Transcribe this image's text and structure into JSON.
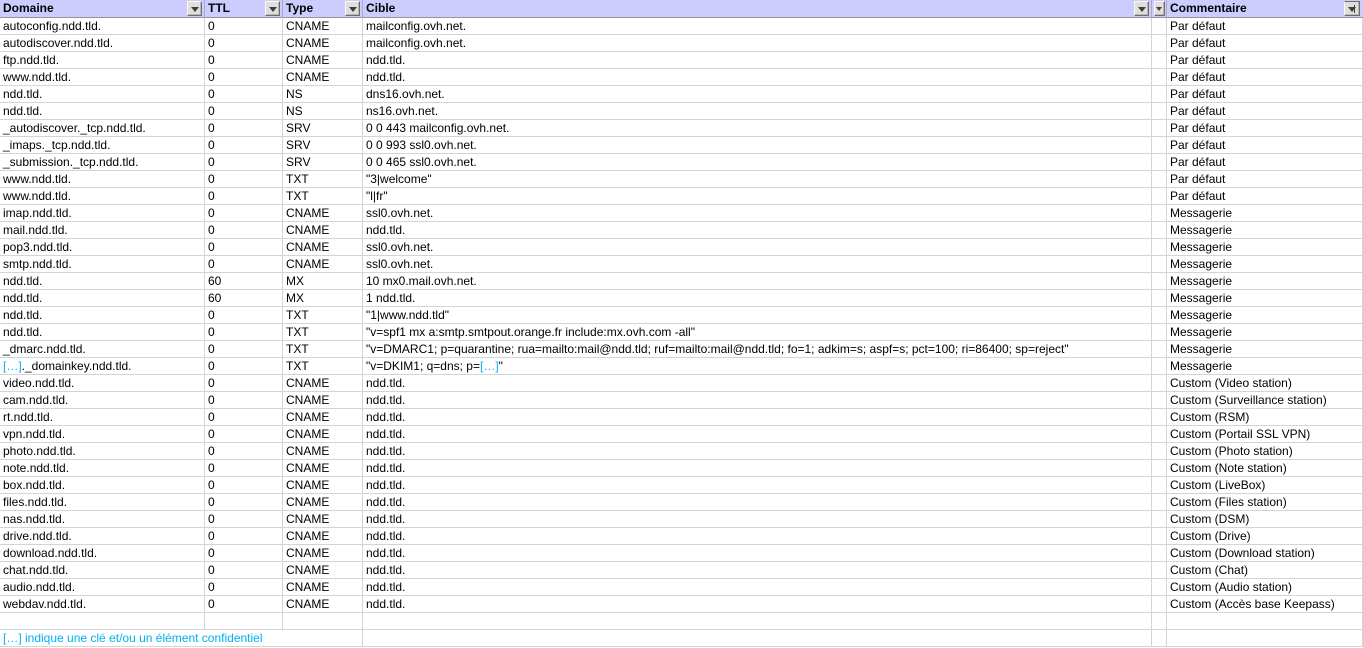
{
  "colors": {
    "header_bg": "#CCCCFF",
    "accent_cyan": "#00B0F0",
    "grid": "#D4D4D4"
  },
  "icons": {
    "filter_dropdown": "▼"
  },
  "header": {
    "columns": [
      "Domaine",
      "TTL",
      "Type",
      "Cible",
      "",
      "Commentaire"
    ]
  },
  "rows": [
    {
      "domaine": "autoconfig.ndd.tld.",
      "ttl": "0",
      "type": "CNAME",
      "cible": "mailconfig.ovh.net.",
      "commentaire": "Par défaut"
    },
    {
      "domaine": "autodiscover.ndd.tld.",
      "ttl": "0",
      "type": "CNAME",
      "cible": "mailconfig.ovh.net.",
      "commentaire": "Par défaut"
    },
    {
      "domaine": "ftp.ndd.tld.",
      "ttl": "0",
      "type": "CNAME",
      "cible": "ndd.tld.",
      "commentaire": "Par défaut"
    },
    {
      "domaine": "www.ndd.tld.",
      "ttl": "0",
      "type": "CNAME",
      "cible": "ndd.tld.",
      "commentaire": "Par défaut"
    },
    {
      "domaine": "ndd.tld.",
      "ttl": "0",
      "type": "NS",
      "cible": "dns16.ovh.net.",
      "commentaire": "Par défaut"
    },
    {
      "domaine": "ndd.tld.",
      "ttl": "0",
      "type": "NS",
      "cible": "ns16.ovh.net.",
      "commentaire": "Par défaut"
    },
    {
      "domaine": "_autodiscover._tcp.ndd.tld.",
      "ttl": "0",
      "type": "SRV",
      "cible": "0 0 443 mailconfig.ovh.net.",
      "commentaire": "Par défaut"
    },
    {
      "domaine": "_imaps._tcp.ndd.tld.",
      "ttl": "0",
      "type": "SRV",
      "cible": "0 0 993 ssl0.ovh.net.",
      "commentaire": "Par défaut"
    },
    {
      "domaine": "_submission._tcp.ndd.tld.",
      "ttl": "0",
      "type": "SRV",
      "cible": "0 0 465 ssl0.ovh.net.",
      "commentaire": "Par défaut"
    },
    {
      "domaine": "www.ndd.tld.",
      "ttl": "0",
      "type": "TXT",
      "cible": "\"3|welcome\"",
      "commentaire": "Par défaut"
    },
    {
      "domaine": "www.ndd.tld.",
      "ttl": "0",
      "type": "TXT",
      "cible": "\"l|fr\"",
      "commentaire": "Par défaut"
    },
    {
      "domaine": "imap.ndd.tld.",
      "ttl": "0",
      "type": "CNAME",
      "cible": "ssl0.ovh.net.",
      "commentaire": "Messagerie"
    },
    {
      "domaine": "mail.ndd.tld.",
      "ttl": "0",
      "type": "CNAME",
      "cible": "ndd.tld.",
      "commentaire": "Messagerie"
    },
    {
      "domaine": "pop3.ndd.tld.",
      "ttl": "0",
      "type": "CNAME",
      "cible": "ssl0.ovh.net.",
      "commentaire": "Messagerie"
    },
    {
      "domaine": "smtp.ndd.tld.",
      "ttl": "0",
      "type": "CNAME",
      "cible": "ssl0.ovh.net.",
      "commentaire": "Messagerie"
    },
    {
      "domaine": "ndd.tld.",
      "ttl": "60",
      "type": "MX",
      "cible": "10 mx0.mail.ovh.net.",
      "commentaire": "Messagerie"
    },
    {
      "domaine": "ndd.tld.",
      "ttl": "60",
      "type": "MX",
      "cible": "1 ndd.tld.",
      "commentaire": "Messagerie"
    },
    {
      "domaine": "ndd.tld.",
      "ttl": "0",
      "type": "TXT",
      "cible": "\"1|www.ndd.tld\"",
      "commentaire": "Messagerie"
    },
    {
      "domaine": "ndd.tld.",
      "ttl": "0",
      "type": "TXT",
      "cible": "\"v=spf1 mx a:smtp.smtpout.orange.fr include:mx.ovh.com -all\"",
      "commentaire": "Messagerie"
    },
    {
      "domaine": "_dmarc.ndd.tld.",
      "ttl": "0",
      "type": "TXT",
      "cible": "\"v=DMARC1; p=quarantine; rua=mailto:mail@ndd.tld; ruf=mailto:mail@ndd.tld; fo=1; adkim=s; aspf=s; pct=100; ri=86400; sp=reject\"",
      "commentaire": "Messagerie"
    },
    {
      "domaine": [
        {
          "t": "[…]",
          "c": true
        },
        {
          "t": "._domainkey.ndd.tld."
        }
      ],
      "ttl": "0",
      "type": "TXT",
      "cible": [
        {
          "t": "\"v=DKIM1; q=dns; p="
        },
        {
          "t": "[…]",
          "c": true
        },
        {
          "t": "\""
        }
      ],
      "commentaire": "Messagerie"
    },
    {
      "domaine": "video.ndd.tld.",
      "ttl": "0",
      "type": "CNAME",
      "cible": "ndd.tld.",
      "commentaire": "Custom (Video station)"
    },
    {
      "domaine": "cam.ndd.tld.",
      "ttl": "0",
      "type": "CNAME",
      "cible": "ndd.tld.",
      "commentaire": "Custom (Surveillance station)"
    },
    {
      "domaine": "rt.ndd.tld.",
      "ttl": "0",
      "type": "CNAME",
      "cible": "ndd.tld.",
      "commentaire": "Custom (RSM)"
    },
    {
      "domaine": "vpn.ndd.tld.",
      "ttl": "0",
      "type": "CNAME",
      "cible": "ndd.tld.",
      "commentaire": "Custom (Portail SSL VPN)"
    },
    {
      "domaine": "photo.ndd.tld.",
      "ttl": "0",
      "type": "CNAME",
      "cible": "ndd.tld.",
      "commentaire": "Custom (Photo station)"
    },
    {
      "domaine": "note.ndd.tld.",
      "ttl": "0",
      "type": "CNAME",
      "cible": "ndd.tld.",
      "commentaire": "Custom (Note station)"
    },
    {
      "domaine": "box.ndd.tld.",
      "ttl": "0",
      "type": "CNAME",
      "cible": "ndd.tld.",
      "commentaire": "Custom (LiveBox)"
    },
    {
      "domaine": "files.ndd.tld.",
      "ttl": "0",
      "type": "CNAME",
      "cible": "ndd.tld.",
      "commentaire": "Custom (Files station)"
    },
    {
      "domaine": "nas.ndd.tld.",
      "ttl": "0",
      "type": "CNAME",
      "cible": "ndd.tld.",
      "commentaire": "Custom (DSM)"
    },
    {
      "domaine": "drive.ndd.tld.",
      "ttl": "0",
      "type": "CNAME",
      "cible": "ndd.tld.",
      "commentaire": "Custom (Drive)"
    },
    {
      "domaine": "download.ndd.tld.",
      "ttl": "0",
      "type": "CNAME",
      "cible": "ndd.tld.",
      "commentaire": "Custom (Download station)"
    },
    {
      "domaine": "chat.ndd.tld.",
      "ttl": "0",
      "type": "CNAME",
      "cible": "ndd.tld.",
      "commentaire": "Custom (Chat)"
    },
    {
      "domaine": "audio.ndd.tld.",
      "ttl": "0",
      "type": "CNAME",
      "cible": "ndd.tld.",
      "commentaire": "Custom (Audio station)"
    },
    {
      "domaine": "webdav.ndd.tld.",
      "ttl": "0",
      "type": "CNAME",
      "cible": "ndd.tld.",
      "commentaire": "Custom (Accès base Keepass)"
    },
    {
      "domaine": "",
      "ttl": "",
      "type": "",
      "cible": "",
      "commentaire": ""
    }
  ],
  "footer": {
    "note": "[…] indique une clé et/ou un élément confidentiel"
  }
}
